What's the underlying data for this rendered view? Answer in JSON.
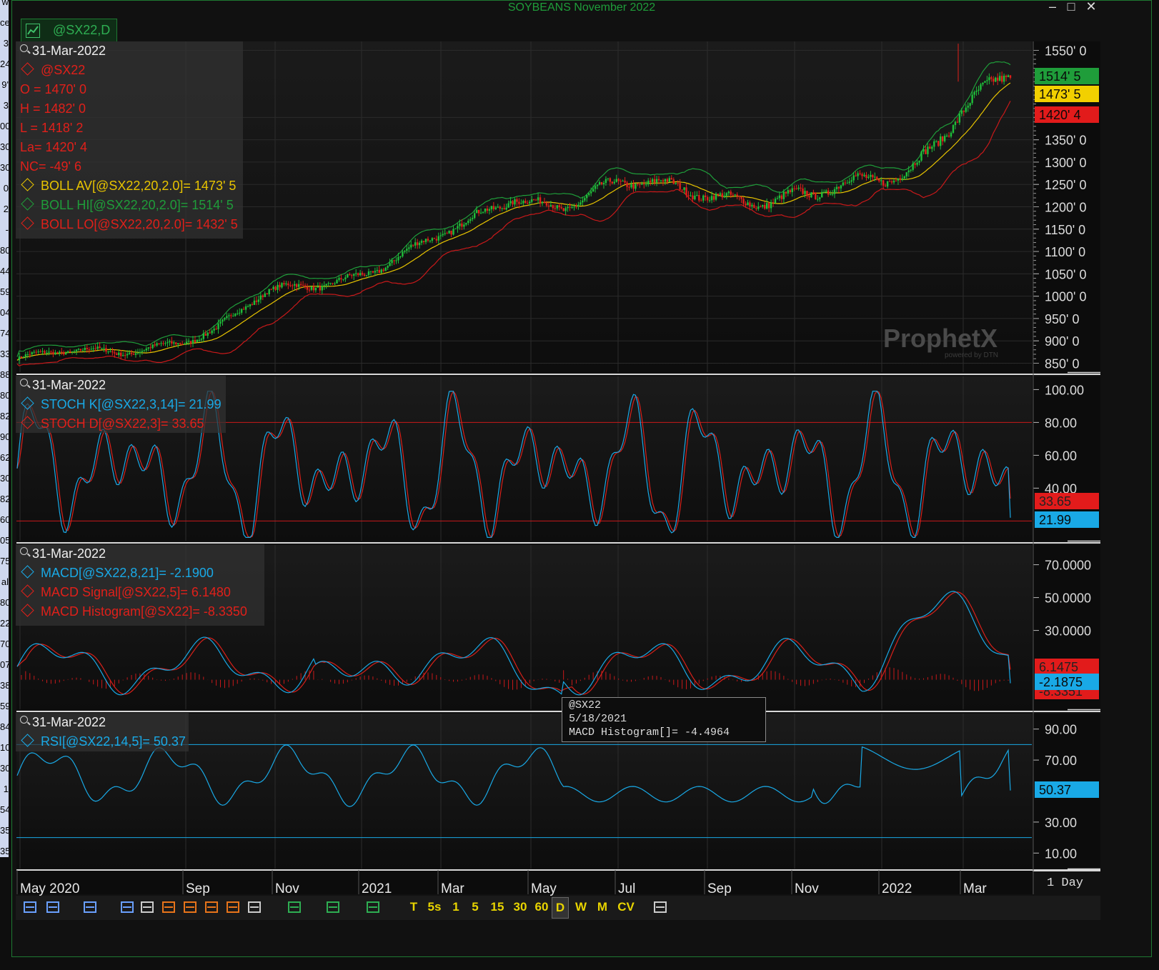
{
  "window": {
    "title": "SOYBEANS November 2022",
    "tab_label": "@SX22,D",
    "controls": [
      "–",
      "□",
      "✕"
    ]
  },
  "left_strip": [
    "w",
    "ce",
    "3",
    "24",
    "9'",
    "3",
    "00",
    "30",
    "30",
    "0",
    "2",
    "-",
    "80",
    "44",
    "59",
    "04",
    "74",
    "33",
    "88",
    "80",
    "82",
    "90",
    "62",
    "30",
    "82",
    "60",
    "05",
    "75",
    "al",
    "80",
    "22",
    "70",
    "07",
    "38",
    "59",
    "84",
    "10",
    "30",
    "1",
    "54",
    "35",
    "35"
  ],
  "panes": {
    "price": {
      "date": "31-Mar-2022",
      "legend": [
        {
          "text": "@SX22",
          "color": "#e0201a"
        },
        {
          "text": "O = 1470' 0",
          "color": "#e0201a",
          "nodia": true
        },
        {
          "text": "H = 1482' 0",
          "color": "#e0201a",
          "nodia": true
        },
        {
          "text": "L = 1418' 2",
          "color": "#e0201a",
          "nodia": true
        },
        {
          "text": "La= 1420' 4",
          "color": "#e0201a",
          "nodia": true
        },
        {
          "text": "NC= -49' 6",
          "color": "#e0201a",
          "nodia": true
        },
        {
          "text": "BOLL AV[@SX22,20,2.0]= 1473' 5",
          "color": "#e8c400"
        },
        {
          "text": "BOLL HI[@SX22,20,2.0]= 1514' 5",
          "color": "#1f9d3a"
        },
        {
          "text": "BOLL LO[@SX22,20,2.0]= 1432' 5",
          "color": "#e0201a"
        }
      ],
      "axis_labels": [
        "1550' 0",
        "1400' 0",
        "1350' 0",
        "1300' 0",
        "1250' 0",
        "1200' 0",
        "1150' 0",
        "1100' 0",
        "1050' 0",
        "1000' 0",
        "950' 0",
        "900' 0",
        "850' 0"
      ],
      "axis_values": [
        1550,
        1400,
        1350,
        1300,
        1250,
        1200,
        1150,
        1100,
        1050,
        1000,
        950,
        900,
        850
      ],
      "badges": [
        {
          "text": "1514' 5",
          "bg": "#1f9d3a",
          "fg": "#0a0a0a",
          "value": 1514.6
        },
        {
          "text": "1473' 5",
          "bg": "#f2d000",
          "fg": "#0a0a0a",
          "value": 1473.6
        },
        {
          "text": "1420' 4",
          "bg": "#e21b1b",
          "fg": "#0a0a0a",
          "value": 1420.5
        }
      ],
      "watermark": "ProphetX",
      "watermark_sub": "powered by DTN"
    },
    "stoch": {
      "date": "31-Mar-2022",
      "legend": [
        {
          "text": "STOCH K[@SX22,3,14]= 21.99",
          "color": "#19a9e6"
        },
        {
          "text": "STOCH D[@SX22,3]= 33.65",
          "color": "#e0201a"
        }
      ],
      "axis_labels": [
        "100.00",
        "80.00",
        "60.00",
        "40.00"
      ],
      "axis_values": [
        100,
        80,
        60,
        40
      ],
      "badges": [
        {
          "text": "33.65",
          "bg": "#e21b1b",
          "fg": "#222",
          "value": 33.65
        },
        {
          "text": "21.99",
          "bg": "#19a9e6",
          "fg": "#0a0a0a",
          "value": 21.99
        }
      ]
    },
    "macd": {
      "date": "31-Mar-2022",
      "legend": [
        {
          "text": "MACD[@SX22,8,21]= -2.1900",
          "color": "#19a9e6"
        },
        {
          "text": "MACD Signal[@SX22,5]= 6.1480",
          "color": "#e0201a"
        },
        {
          "text": "MACD Histogram[@SX22]= -8.3350",
          "color": "#e0201a"
        }
      ],
      "axis_labels": [
        "70.0000",
        "50.0000",
        "30.0000"
      ],
      "axis_values": [
        70,
        50,
        30
      ],
      "badges": [
        {
          "text": "6.1475",
          "bg": "#e21b1b",
          "fg": "#222",
          "value": 6.1475
        },
        {
          "text": "-8.3351",
          "bg": "#e21b1b",
          "fg": "#222",
          "value": -8.3351
        },
        {
          "text": "-2.1875",
          "bg": "#19a9e6",
          "fg": "#0a0a0a",
          "value": -2.1875
        }
      ]
    },
    "rsi": {
      "date": "31-Mar-2022",
      "legend": [
        {
          "text": "RSI[@SX22,14,5]= 50.37",
          "color": "#19a9e6"
        }
      ],
      "axis_labels": [
        "90.00",
        "70.00",
        "30.00",
        "10.00"
      ],
      "axis_values": [
        90,
        70,
        30,
        10
      ],
      "badges": [
        {
          "text": "50.37",
          "bg": "#19a9e6",
          "fg": "#0a0a0a",
          "value": 50.37
        }
      ]
    }
  },
  "x_axis": {
    "labels": [
      "May 2020",
      "Sep",
      "Nov",
      "2021",
      "Mar",
      "May",
      "Jul",
      "Sep",
      "Nov",
      "2022",
      "Mar"
    ],
    "period": "1 Day"
  },
  "tooltip": {
    "symbol": "@SX22",
    "date": "5/18/2021",
    "text": "MACD Histogram[]= -4.4964"
  },
  "toolbar": {
    "intervals": [
      "T",
      "5s",
      "1",
      "5",
      "15",
      "30",
      "60",
      "D",
      "W",
      "M",
      "CV"
    ],
    "selected": "D"
  },
  "chart_data": [
    {
      "type": "line",
      "title": "SOYBEANS November 2022",
      "series_note": "daily OHLC candles with Bollinger Bands (20, 2.0)",
      "x": [
        "2020-05",
        "2020-07",
        "2020-09",
        "2020-10",
        "2020-11",
        "2020-12",
        "2021-01",
        "2021-02",
        "2021-03",
        "2021-04",
        "2021-05",
        "2021-06",
        "2021-07",
        "2021-08",
        "2021-09",
        "2021-10",
        "2021-11",
        "2021-12",
        "2022-01",
        "2022-02",
        "2022-03"
      ],
      "series": [
        {
          "name": "@SX22",
          "values": [
            860,
            870,
            875,
            900,
            920,
            1000,
            1030,
            1060,
            1100,
            1150,
            1230,
            1210,
            1240,
            1240,
            1240,
            1220,
            1210,
            1250,
            1300,
            1420,
            1480
          ]
        },
        {
          "name": "BOLL AV[@SX22,20,2.0]",
          "values": [
            858,
            866,
            880,
            895,
            915,
            985,
            1020,
            1050,
            1085,
            1135,
            1210,
            1220,
            1240,
            1240,
            1240,
            1225,
            1215,
            1240,
            1290,
            1400,
            1474
          ]
        },
        {
          "name": "BOLL HI[@SX22,20,2.0]",
          "values": [
            875,
            885,
            900,
            920,
            945,
            1020,
            1060,
            1090,
            1120,
            1180,
            1290,
            1270,
            1270,
            1265,
            1260,
            1250,
            1245,
            1270,
            1330,
            1480,
            1515
          ]
        },
        {
          "name": "BOLL LO[@SX22,20,2.0]",
          "values": [
            845,
            850,
            862,
            870,
            900,
            950,
            985,
            1010,
            1050,
            1090,
            1125,
            1165,
            1210,
            1215,
            1220,
            1205,
            1190,
            1210,
            1250,
            1340,
            1433
          ]
        }
      ],
      "ylim": [
        830,
        1570
      ]
    },
    {
      "type": "line",
      "series": [
        {
          "name": "STOCH K[@SX22,3,14]",
          "last": 21.99
        },
        {
          "name": "STOCH D[@SX22,3]",
          "last": 33.65
        }
      ],
      "ylim": [
        0,
        110
      ],
      "reference_lines": [
        80,
        20
      ]
    },
    {
      "type": "line",
      "series": [
        {
          "name": "MACD[@SX22,8,21]",
          "last": -2.19
        },
        {
          "name": "MACD Signal[@SX22,5]",
          "last": 6.148
        },
        {
          "name": "MACD Histogram[@SX22]",
          "last": -8.335
        }
      ],
      "ylim": [
        -15,
        80
      ]
    },
    {
      "type": "line",
      "series": [
        {
          "name": "RSI[@SX22,14,5]",
          "last": 50.37
        }
      ],
      "ylim": [
        0,
        100
      ],
      "reference_lines": [
        80,
        20
      ]
    }
  ],
  "colors": {
    "green": "#1f9d3a",
    "yellow": "#e8c400",
    "red": "#e0201a",
    "blue": "#19a9e6",
    "bg": "#111111",
    "grid": "#2a2a2a"
  }
}
